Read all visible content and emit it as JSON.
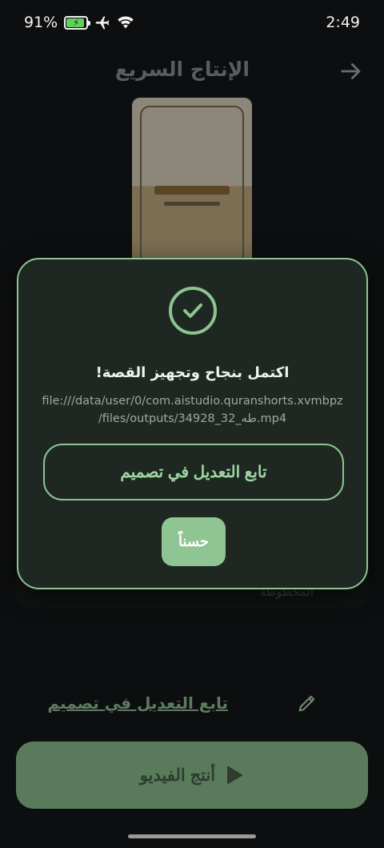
{
  "status_bar": {
    "battery_percent": "91%",
    "time": "2:49",
    "icons": [
      "battery-charging-icon",
      "airplane-mode-icon",
      "wifi-icon"
    ]
  },
  "header": {
    "title": "الإنتاج السريع",
    "back_icon": "arrow-right-icon"
  },
  "background": {
    "under_card_label": "المخطوطة",
    "continue_link": "تابع التعديل في تصميم",
    "edit_icon": "pencil-icon",
    "produce_button": "أنتج الفيديو",
    "produce_icon": "play-icon"
  },
  "modal": {
    "icon": "check-circle-icon",
    "title": "اكتمل بنجاح وتجهيز القصة!",
    "path_line1": "file:///data/user/0/com.aistudio.quranshorts.xvmbpz",
    "path_line2": "/files/outputs/34928_32_طه.mp4",
    "continue_button": "تابع التعديل في تصميم",
    "ok_button": "حسناً"
  },
  "colors": {
    "accent": "#8cc590",
    "modal_bg": "#1e2722",
    "background": "#0d0e0f",
    "produce_button_bg": "#5a7a5c"
  }
}
